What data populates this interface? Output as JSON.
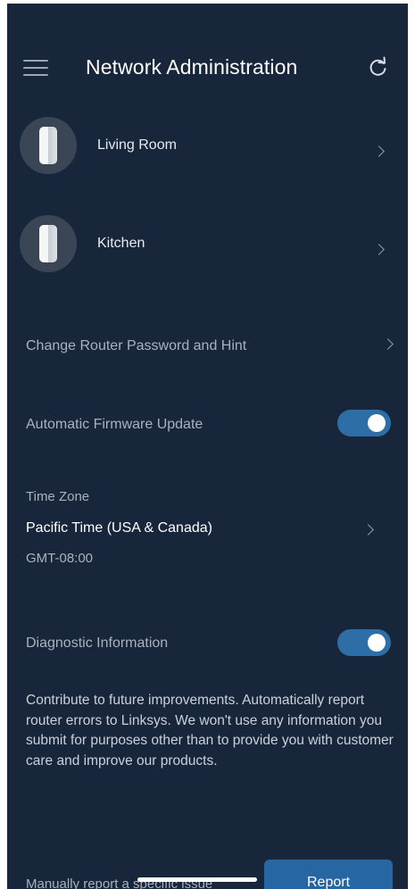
{
  "header": {
    "title": "Network Administration"
  },
  "nodes": [
    {
      "label": "Living Room"
    },
    {
      "label": "Kitchen"
    }
  ],
  "settings": {
    "password_label": "Change Router Password and Hint",
    "firmware_label": "Automatic Firmware Update",
    "firmware_enabled": true,
    "timezone_label": "Time Zone",
    "timezone_value": "Pacific Time (USA & Canada)",
    "timezone_offset": "GMT-08:00",
    "diagnostic_label": "Diagnostic Information",
    "diagnostic_enabled": true,
    "diagnostic_description": "Contribute to future improvements. Automatically report router errors to Linksys. We won't use any information you submit for purposes other than to provide you with customer care and improve our products.",
    "manual_report_label": "Manually report a specific issue",
    "report_button": "Report"
  },
  "icons": {
    "menu": "hamburger-menu-icon",
    "refresh": "refresh-icon",
    "node": "router-node-icon",
    "chevron": "chevron-right-icon"
  },
  "colors": {
    "background": "#17263a",
    "accent": "#2d6ea6",
    "button": "#2566a3"
  }
}
